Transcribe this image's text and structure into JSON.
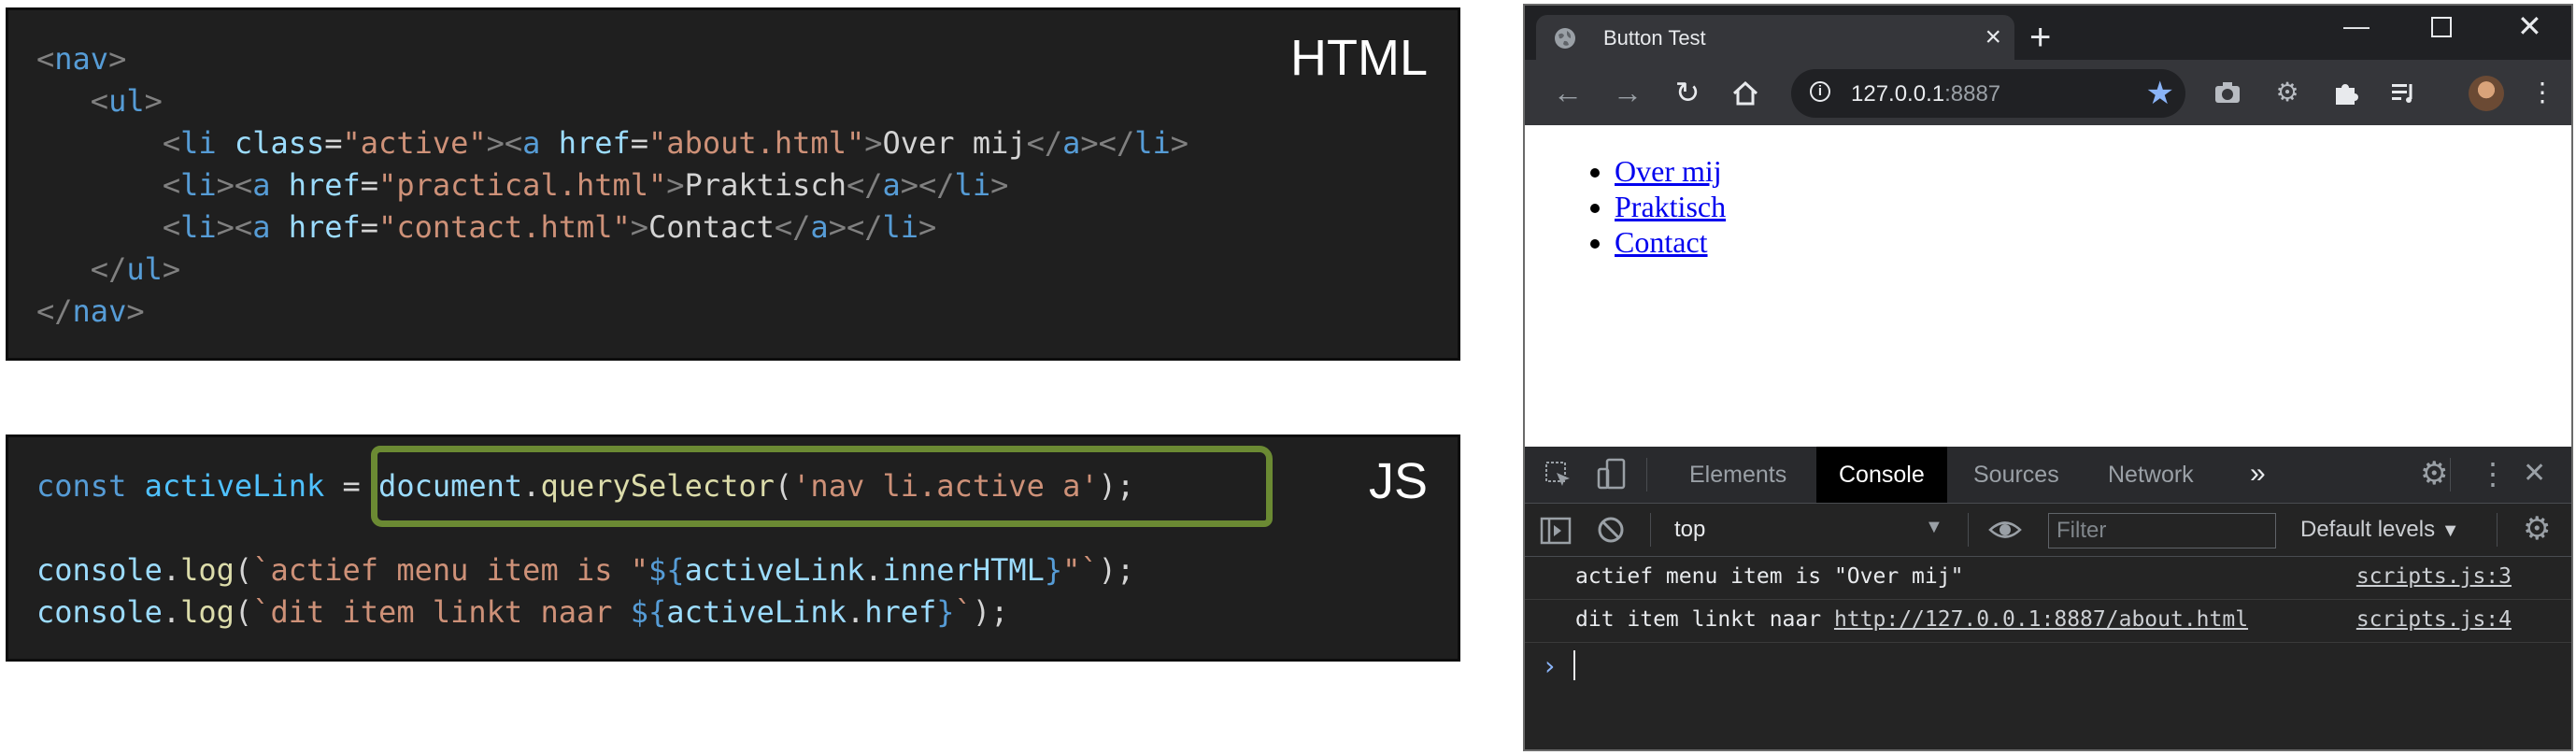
{
  "html_panel": {
    "label": "HTML",
    "lines": [
      "<nav>",
      "   <ul>",
      "       <li class=\"active\"><a href=\"about.html\">Over mij</a></li>",
      "       <li><a href=\"practical.html\">Praktisch</a></li>",
      "       <li><a href=\"contact.html\">Contact</a></li>",
      "   </ul>",
      "</nav>"
    ]
  },
  "js_panel": {
    "label": "JS",
    "lines": [
      "const activeLink = document.querySelector('nav li.active a');",
      "",
      "console.log(`actief menu item is \"${activeLink.innerHTML}\"`);",
      "console.log(`dit item linkt naar ${activeLink.href}`);"
    ]
  },
  "browser": {
    "tab_title": "Button Test",
    "url_host": "127.0.0.1",
    "url_port": ":8887",
    "page_links": [
      "Over mij",
      "Praktisch",
      "Contact"
    ],
    "devtools": {
      "tabs": [
        "Elements",
        "Console",
        "Sources",
        "Network"
      ],
      "active_tab": "Console",
      "context": "top",
      "filter_placeholder": "Filter",
      "levels": "Default levels",
      "logs": [
        {
          "text": "actief menu item is \"Over mij\"",
          "link": "",
          "source": "scripts.js:3"
        },
        {
          "text": "dit item linkt naar ",
          "link": "http://127.0.0.1:8887/about.html",
          "source": "scripts.js:4"
        }
      ]
    }
  },
  "colors": {
    "code_bg": "#1f1f1f",
    "highlight_box": "#6b8a33",
    "link": "#0000ee",
    "chrome_dark": "#202124"
  }
}
